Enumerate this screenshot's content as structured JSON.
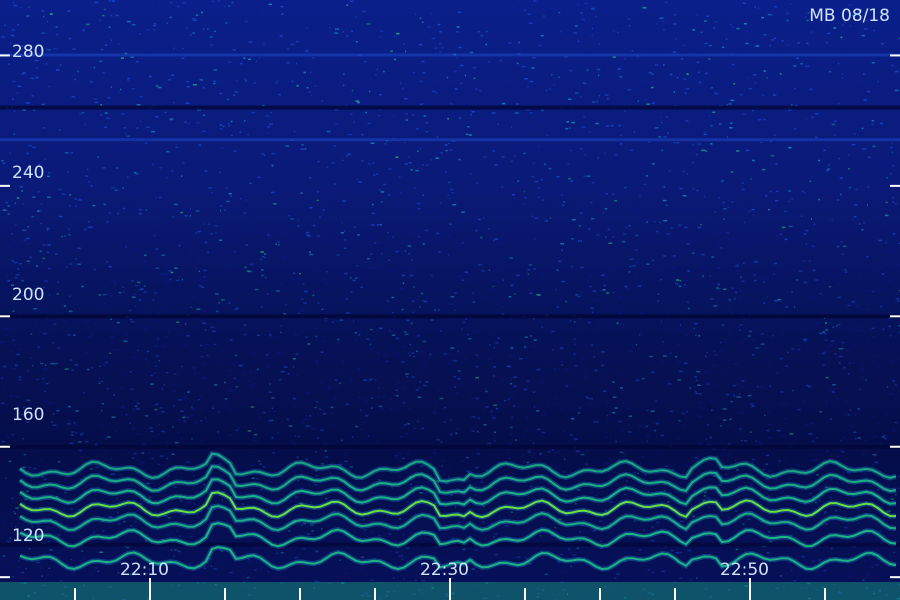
{
  "chart_data": {
    "type": "heatmap",
    "title": "MB 08/18",
    "xlabel": "",
    "ylabel": "",
    "y_ticks": [
      120,
      160,
      200,
      240,
      280
    ],
    "ylim": [
      113,
      297
    ],
    "x_ticks": [
      "22:10",
      "22:30",
      "22:50"
    ],
    "x_tick_minutes": [
      10,
      30,
      50
    ],
    "xlim_minutes": [
      0,
      60
    ],
    "colormap": [
      "#050a3c",
      "#0a1a8c",
      "#1f4fd8",
      "#1aa0c8",
      "#22d18a",
      "#7cf23a"
    ],
    "harmonic_bands": [
      {
        "y": 125,
        "intensity": 0.75
      },
      {
        "y": 132,
        "intensity": 0.8
      },
      {
        "y": 137,
        "intensity": 0.7
      },
      {
        "y": 141,
        "intensity": 0.95
      },
      {
        "y": 145,
        "intensity": 0.75
      },
      {
        "y": 149,
        "intensity": 0.7
      },
      {
        "y": 153,
        "intensity": 0.6
      }
    ],
    "dark_rows": [
      130,
      160,
      200,
      264
    ],
    "bright_rows": [
      254,
      280
    ]
  },
  "colors": {
    "text": "#cfe3ff",
    "tick": "#ffffff"
  }
}
